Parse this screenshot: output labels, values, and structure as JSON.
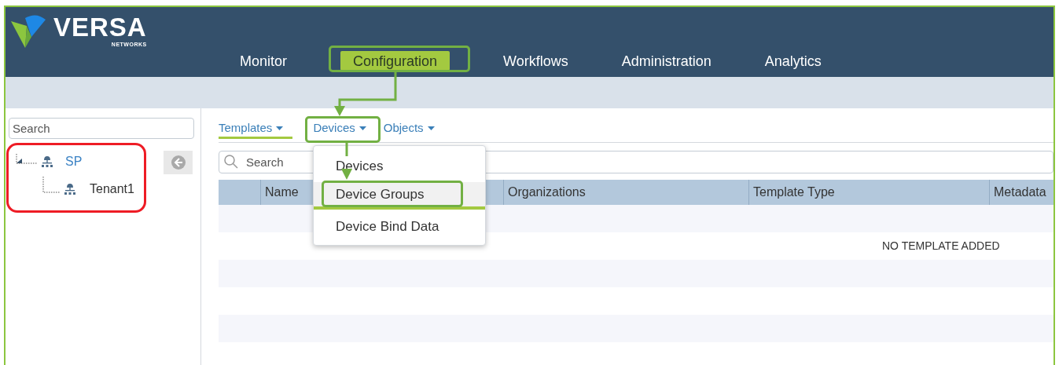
{
  "logo": {
    "name": "VERSA",
    "sub": "NETWORKS"
  },
  "nav": [
    {
      "label": "Monitor",
      "selected": false
    },
    {
      "label": "Configuration",
      "selected": true
    },
    {
      "label": "Workflows",
      "selected": false
    },
    {
      "label": "Administration",
      "selected": false
    },
    {
      "label": "Analytics",
      "selected": false
    }
  ],
  "sidebar": {
    "search": {
      "placeholder": "Search"
    },
    "tree": [
      {
        "label": "SP",
        "selected": true,
        "children": [
          {
            "label": "Tenant1",
            "selected": false
          }
        ]
      }
    ]
  },
  "subtabs": [
    {
      "label": "Templates",
      "selected": true
    },
    {
      "label": "Devices",
      "selected": false
    },
    {
      "label": "Objects",
      "selected": false
    }
  ],
  "dropdown": {
    "items": [
      {
        "label": "Devices",
        "selected": false
      },
      {
        "label": "Device Groups",
        "selected": true
      },
      {
        "label": "Device Bind Data",
        "selected": false
      }
    ]
  },
  "table": {
    "search": {
      "placeholder": "Search"
    },
    "columns": [
      {
        "label": "Name"
      },
      {
        "label": "Organizations"
      },
      {
        "label": "Template Type"
      },
      {
        "label": "Metadata"
      }
    ],
    "empty_message": "NO TEMPLATE ADDED"
  }
}
